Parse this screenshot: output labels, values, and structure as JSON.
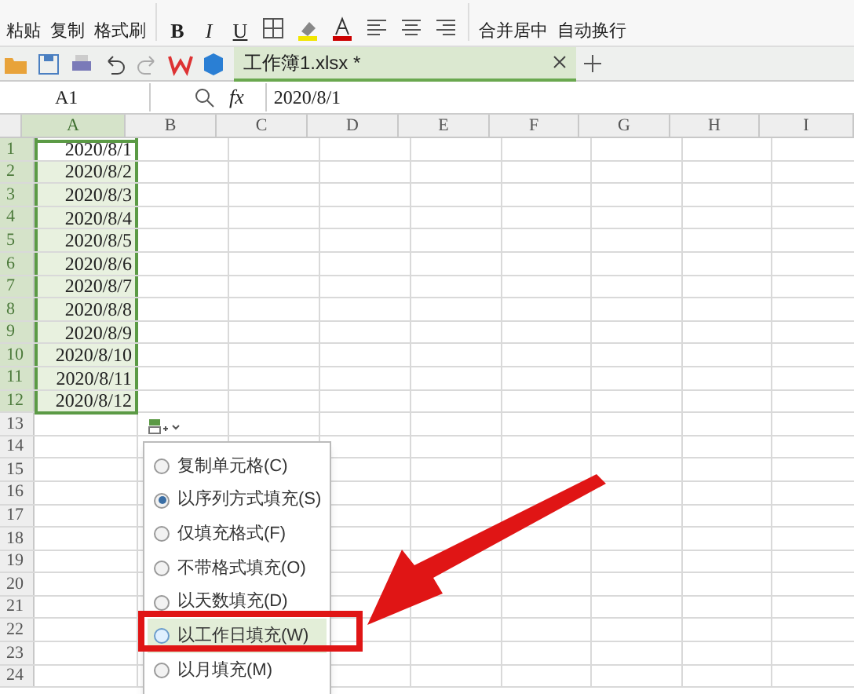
{
  "ribbon": {
    "clipboard": [
      "粘贴",
      "复制",
      "格式刷"
    ],
    "font_buttons": [
      "B",
      "I",
      "U"
    ],
    "merge": "合并居中",
    "wrap": "自动换行"
  },
  "tabs": [
    {
      "label": "工作簿1.xlsx *",
      "selected": true
    }
  ],
  "formula_bar": {
    "cell": "A1",
    "fx": "fx",
    "value": "2020/8/1"
  },
  "columns": [
    "A",
    "B",
    "C",
    "D",
    "E",
    "F",
    "G",
    "H",
    "I"
  ],
  "rows": [
    {
      "n": "1",
      "a": "2020/8/1"
    },
    {
      "n": "2",
      "a": "2020/8/2"
    },
    {
      "n": "3",
      "a": "2020/8/3"
    },
    {
      "n": "4",
      "a": "2020/8/4"
    },
    {
      "n": "5",
      "a": "2020/8/5"
    },
    {
      "n": "6",
      "a": "2020/8/6"
    },
    {
      "n": "7",
      "a": "2020/8/7"
    },
    {
      "n": "8",
      "a": "2020/8/8"
    },
    {
      "n": "9",
      "a": "2020/8/9"
    },
    {
      "n": "10",
      "a": "2020/8/10"
    },
    {
      "n": "11",
      "a": "2020/8/11"
    },
    {
      "n": "12",
      "a": "2020/8/12"
    },
    {
      "n": "13"
    },
    {
      "n": "14"
    },
    {
      "n": "15"
    },
    {
      "n": "16"
    },
    {
      "n": "17"
    },
    {
      "n": "18"
    },
    {
      "n": "19"
    },
    {
      "n": "20"
    },
    {
      "n": "21"
    },
    {
      "n": "22"
    },
    {
      "n": "23"
    },
    {
      "n": "24"
    }
  ],
  "fill_menu": [
    {
      "label": "复制单元格(C)",
      "selected": false,
      "hovered": false
    },
    {
      "label": "以序列方式填充(S)",
      "selected": true,
      "hovered": false
    },
    {
      "label": "仅填充格式(F)",
      "selected": false,
      "hovered": false
    },
    {
      "label": "不带格式填充(O)",
      "selected": false,
      "hovered": false
    },
    {
      "label": "以天数填充(D)",
      "selected": false,
      "hovered": false
    },
    {
      "label": "以工作日填充(W)",
      "selected": false,
      "hovered": true
    },
    {
      "label": "以月填充(M)",
      "selected": false,
      "hovered": false
    }
  ]
}
